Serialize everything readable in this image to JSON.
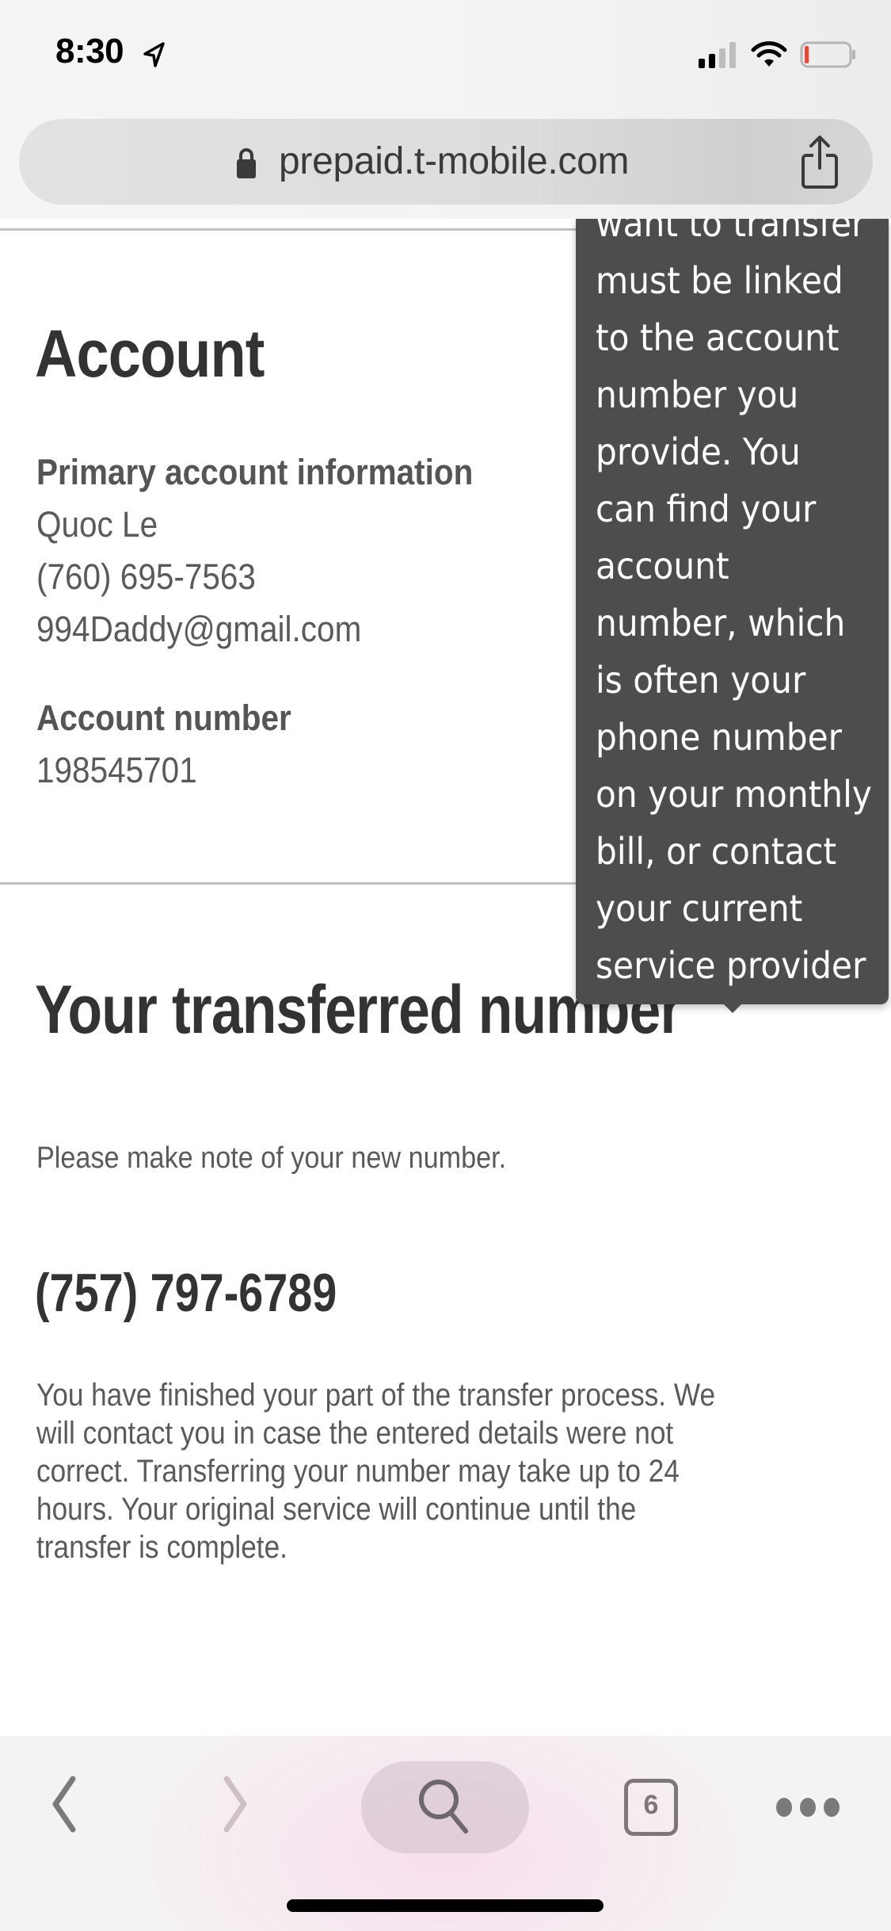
{
  "status_bar": {
    "time": "8:30",
    "icons": [
      "location-arrow-icon",
      "cellular-signal-icon",
      "wifi-icon",
      "battery-low-icon"
    ]
  },
  "browser": {
    "url": "prepaid.t-mobile.com",
    "secure_icon": "lock-icon",
    "share_icon": "share-icon",
    "toolbar": {
      "back_icon": "chevron-left-icon",
      "forward_icon": "chevron-right-icon",
      "search_icon": "search-icon",
      "tab_count": "6",
      "more_icon": "ellipsis-icon"
    }
  },
  "account": {
    "heading": "Account",
    "primary_label": "Primary account information",
    "name": "Quoc Le",
    "phone": "(760) 695-7563",
    "email": "994Daddy@gmail.com",
    "account_number_label": "Account number",
    "account_number": "198545701"
  },
  "transfer": {
    "heading": "Your transferred number",
    "note": "Please make note of your new number.",
    "new_number": "(757) 797-6789",
    "paragraph": "You have finished your part of the transfer process. We\nwill contact you in  case the entered details were not\ncorrect. Transferring your number may take up to 24\nhours. Your original service will continue until the\ntransfer is  complete."
  },
  "tooltip": {
    "lines": [
      "want to transfer",
      "must be linked",
      "to the account",
      "number you",
      "provide. You",
      "can find your",
      "account",
      "number, which",
      "is often your",
      "phone number",
      "on your monthly",
      "bill, or contact",
      "your current",
      "service provider"
    ]
  },
  "colors": {
    "tooltip_bg": "#4d4d4d",
    "heading_text": "#333333",
    "body_text": "#5a5a5a",
    "battery_low": "#e8453c"
  }
}
